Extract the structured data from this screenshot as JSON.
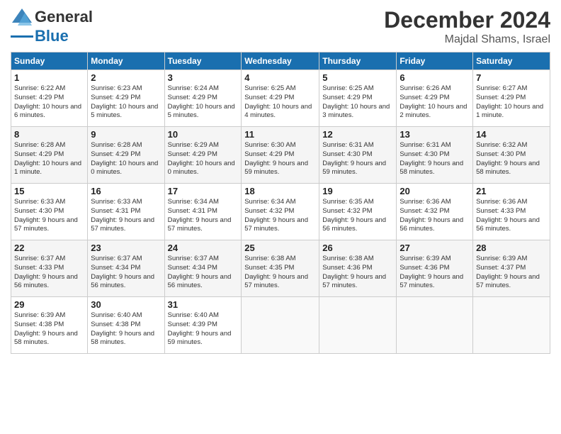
{
  "header": {
    "logo_general": "General",
    "logo_blue": "Blue",
    "month_year": "December 2024",
    "location": "Majdal Shams, Israel"
  },
  "weekdays": [
    "Sunday",
    "Monday",
    "Tuesday",
    "Wednesday",
    "Thursday",
    "Friday",
    "Saturday"
  ],
  "weeks": [
    [
      {
        "day": "1",
        "sunrise": "6:22 AM",
        "sunset": "4:29 PM",
        "daylight": "10 hours and 6 minutes."
      },
      {
        "day": "2",
        "sunrise": "6:23 AM",
        "sunset": "4:29 PM",
        "daylight": "10 hours and 5 minutes."
      },
      {
        "day": "3",
        "sunrise": "6:24 AM",
        "sunset": "4:29 PM",
        "daylight": "10 hours and 5 minutes."
      },
      {
        "day": "4",
        "sunrise": "6:25 AM",
        "sunset": "4:29 PM",
        "daylight": "10 hours and 4 minutes."
      },
      {
        "day": "5",
        "sunrise": "6:25 AM",
        "sunset": "4:29 PM",
        "daylight": "10 hours and 3 minutes."
      },
      {
        "day": "6",
        "sunrise": "6:26 AM",
        "sunset": "4:29 PM",
        "daylight": "10 hours and 2 minutes."
      },
      {
        "day": "7",
        "sunrise": "6:27 AM",
        "sunset": "4:29 PM",
        "daylight": "10 hours and 1 minute."
      }
    ],
    [
      {
        "day": "8",
        "sunrise": "6:28 AM",
        "sunset": "4:29 PM",
        "daylight": "10 hours and 1 minute."
      },
      {
        "day": "9",
        "sunrise": "6:28 AM",
        "sunset": "4:29 PM",
        "daylight": "10 hours and 0 minutes."
      },
      {
        "day": "10",
        "sunrise": "6:29 AM",
        "sunset": "4:29 PM",
        "daylight": "10 hours and 0 minutes."
      },
      {
        "day": "11",
        "sunrise": "6:30 AM",
        "sunset": "4:29 PM",
        "daylight": "9 hours and 59 minutes."
      },
      {
        "day": "12",
        "sunrise": "6:31 AM",
        "sunset": "4:30 PM",
        "daylight": "9 hours and 59 minutes."
      },
      {
        "day": "13",
        "sunrise": "6:31 AM",
        "sunset": "4:30 PM",
        "daylight": "9 hours and 58 minutes."
      },
      {
        "day": "14",
        "sunrise": "6:32 AM",
        "sunset": "4:30 PM",
        "daylight": "9 hours and 58 minutes."
      }
    ],
    [
      {
        "day": "15",
        "sunrise": "6:33 AM",
        "sunset": "4:30 PM",
        "daylight": "9 hours and 57 minutes."
      },
      {
        "day": "16",
        "sunrise": "6:33 AM",
        "sunset": "4:31 PM",
        "daylight": "9 hours and 57 minutes."
      },
      {
        "day": "17",
        "sunrise": "6:34 AM",
        "sunset": "4:31 PM",
        "daylight": "9 hours and 57 minutes."
      },
      {
        "day": "18",
        "sunrise": "6:34 AM",
        "sunset": "4:32 PM",
        "daylight": "9 hours and 57 minutes."
      },
      {
        "day": "19",
        "sunrise": "6:35 AM",
        "sunset": "4:32 PM",
        "daylight": "9 hours and 56 minutes."
      },
      {
        "day": "20",
        "sunrise": "6:36 AM",
        "sunset": "4:32 PM",
        "daylight": "9 hours and 56 minutes."
      },
      {
        "day": "21",
        "sunrise": "6:36 AM",
        "sunset": "4:33 PM",
        "daylight": "9 hours and 56 minutes."
      }
    ],
    [
      {
        "day": "22",
        "sunrise": "6:37 AM",
        "sunset": "4:33 PM",
        "daylight": "9 hours and 56 minutes."
      },
      {
        "day": "23",
        "sunrise": "6:37 AM",
        "sunset": "4:34 PM",
        "daylight": "9 hours and 56 minutes."
      },
      {
        "day": "24",
        "sunrise": "6:37 AM",
        "sunset": "4:34 PM",
        "daylight": "9 hours and 56 minutes."
      },
      {
        "day": "25",
        "sunrise": "6:38 AM",
        "sunset": "4:35 PM",
        "daylight": "9 hours and 57 minutes."
      },
      {
        "day": "26",
        "sunrise": "6:38 AM",
        "sunset": "4:36 PM",
        "daylight": "9 hours and 57 minutes."
      },
      {
        "day": "27",
        "sunrise": "6:39 AM",
        "sunset": "4:36 PM",
        "daylight": "9 hours and 57 minutes."
      },
      {
        "day": "28",
        "sunrise": "6:39 AM",
        "sunset": "4:37 PM",
        "daylight": "9 hours and 57 minutes."
      }
    ],
    [
      {
        "day": "29",
        "sunrise": "6:39 AM",
        "sunset": "4:38 PM",
        "daylight": "9 hours and 58 minutes."
      },
      {
        "day": "30",
        "sunrise": "6:40 AM",
        "sunset": "4:38 PM",
        "daylight": "9 hours and 58 minutes."
      },
      {
        "day": "31",
        "sunrise": "6:40 AM",
        "sunset": "4:39 PM",
        "daylight": "9 hours and 59 minutes."
      },
      null,
      null,
      null,
      null
    ]
  ]
}
